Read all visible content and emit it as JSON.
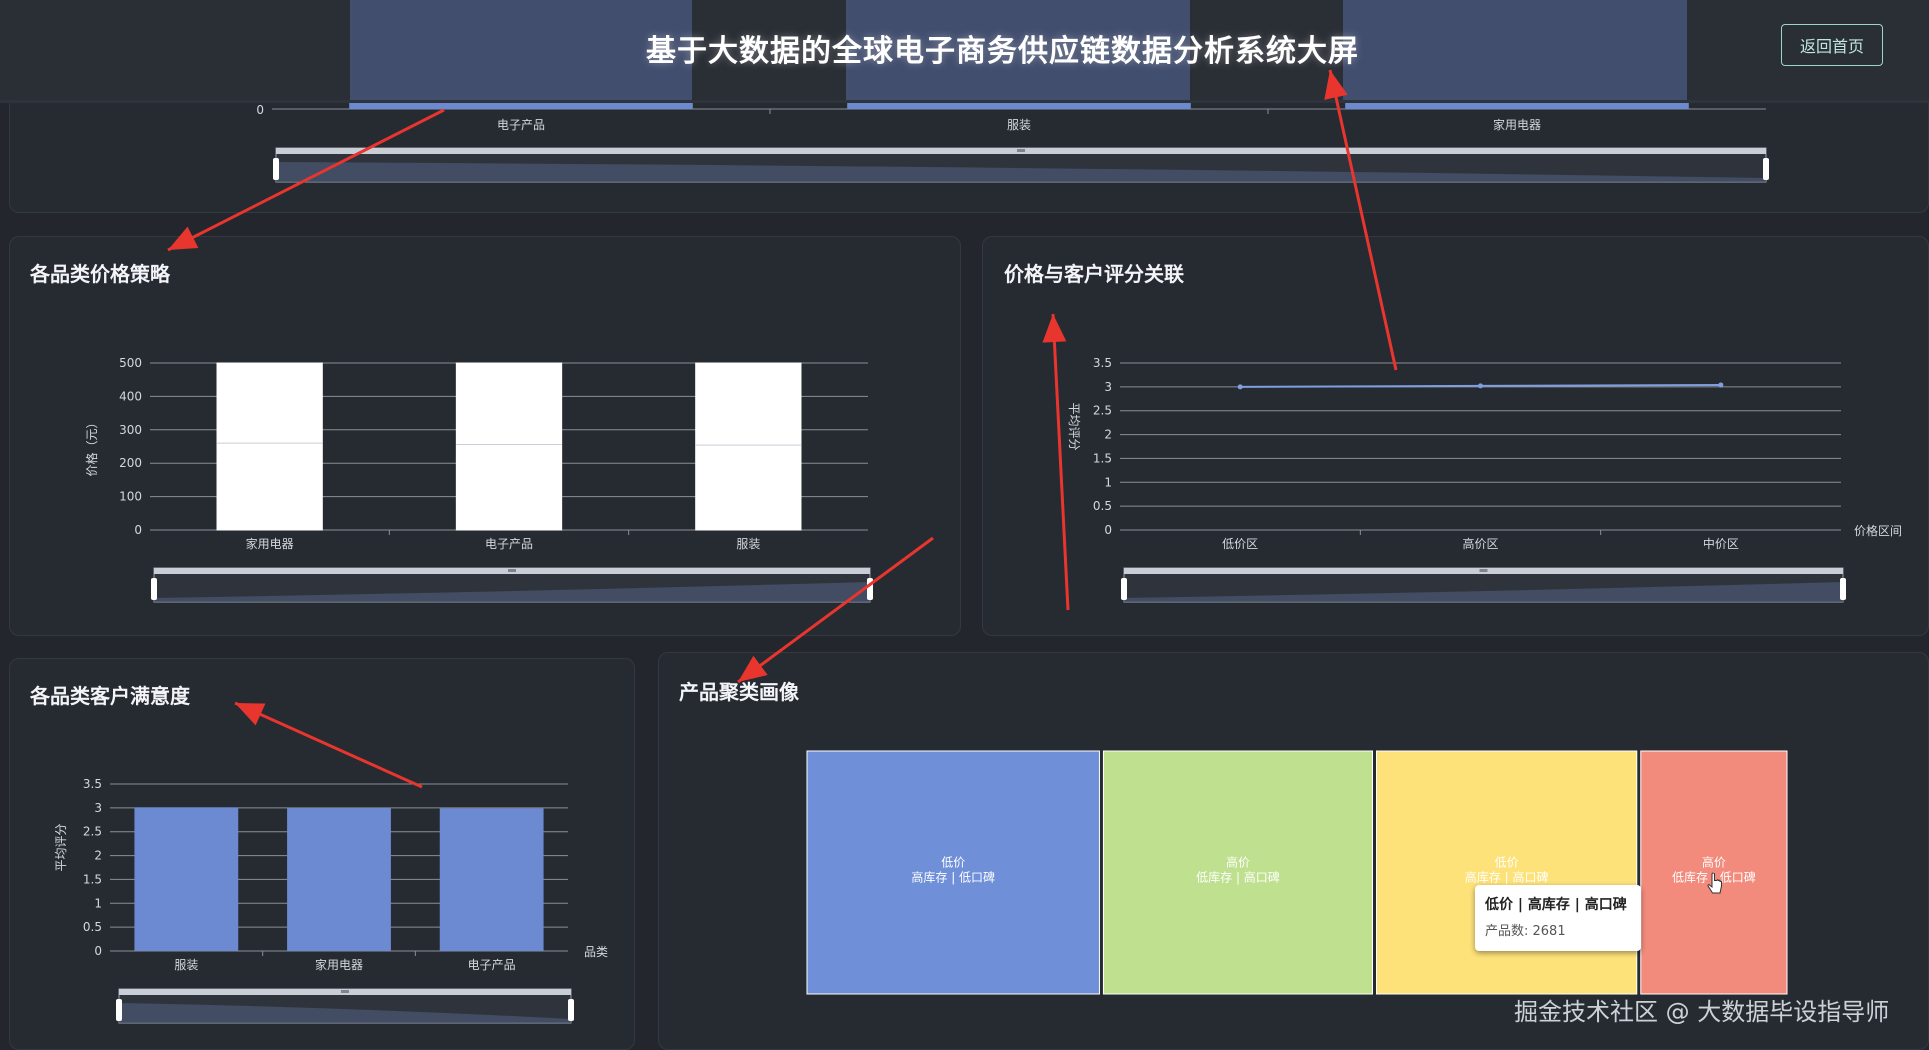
{
  "header": {
    "title": "基于大数据的全球电子商务供应链数据分析系统大屏",
    "back_label": "返回首页"
  },
  "watermark": "掘金技术社区 @ 大数据毕设指导师",
  "colors": {
    "background": "#23262c",
    "panel": "#262a31",
    "bar_blue": "#6c8ad1",
    "line_blue": "#7f9fe0",
    "grid": "#8b8f96",
    "arrow_red": "#e8352e",
    "treemap_blue": "#6f8fd8",
    "treemap_green": "#bfe08f",
    "treemap_yellow": "#fde27a",
    "treemap_red": "#f28b7c"
  },
  "panels": {
    "top": {},
    "price_strategy": {
      "title": "各品类价格策略"
    },
    "price_rating": {
      "title": "价格与客户评分关联"
    },
    "satisfaction": {
      "title": "各品类客户满意度"
    },
    "cluster": {
      "title": "产品聚类画像"
    }
  },
  "chart_data": [
    {
      "id": "top-bar",
      "type": "bar",
      "categories": [
        "电子产品",
        "服装",
        "家用电器"
      ],
      "yticks": [
        "0"
      ],
      "slider": true
    },
    {
      "id": "price-strategy",
      "type": "boxplot",
      "title": "各品类价格策略",
      "ylabel": "价格（元）",
      "categories": [
        "家用电器",
        "电子产品",
        "服装"
      ],
      "boxes": [
        {
          "low": 0,
          "q1": 0,
          "median": 260,
          "q3": 500,
          "high": 500
        },
        {
          "low": 0,
          "q1": 0,
          "median": 256,
          "q3": 500,
          "high": 500
        },
        {
          "low": 0,
          "q1": 0,
          "median": 254,
          "q3": 500,
          "high": 500
        }
      ],
      "ylim": [
        0,
        500
      ],
      "yticks": [
        0,
        100,
        200,
        300,
        400,
        500
      ],
      "slider": true
    },
    {
      "id": "price-rating",
      "type": "line",
      "title": "价格与客户评分关联",
      "ylabel": "平均评分",
      "xlabel": "价格区间",
      "categories": [
        "低价区",
        "高价区",
        "中价区"
      ],
      "values": [
        3.0,
        3.02,
        3.04
      ],
      "ylim": [
        0,
        3.5
      ],
      "yticks": [
        0,
        0.5,
        1,
        1.5,
        2,
        2.5,
        3,
        3.5
      ],
      "slider": true
    },
    {
      "id": "satisfaction",
      "type": "bar",
      "title": "各品类客户满意度",
      "ylabel": "平均评分",
      "xlabel": "品类",
      "categories": [
        "服装",
        "家用电器",
        "电子产品"
      ],
      "values": [
        3.01,
        3.0,
        2.99
      ],
      "ylim": [
        0,
        3.5
      ],
      "yticks": [
        0,
        0.5,
        1,
        1.5,
        2,
        2.5,
        3,
        3.5
      ],
      "slider": true
    },
    {
      "id": "cluster",
      "type": "treemap",
      "title": "产品聚类画像",
      "items": [
        {
          "line1": "低价",
          "line2": "高库存 | 低口碑",
          "weight": 1.0,
          "color": "#6f8fd8"
        },
        {
          "line1": "高价",
          "line2": "低库存 | 高口碑",
          "weight": 0.92,
          "color": "#bfe08f"
        },
        {
          "line1": "低价",
          "line2": "高库存 | 高口碑",
          "weight": 0.89,
          "color": "#fde27a"
        },
        {
          "line1": "高价",
          "line2": "低库存 | 低口碑",
          "weight": 0.5,
          "color": "#f28b7c"
        }
      ],
      "tooltip": {
        "title": "低价 | 高库存 | 高口碑",
        "body": "产品数: 2681"
      }
    }
  ]
}
